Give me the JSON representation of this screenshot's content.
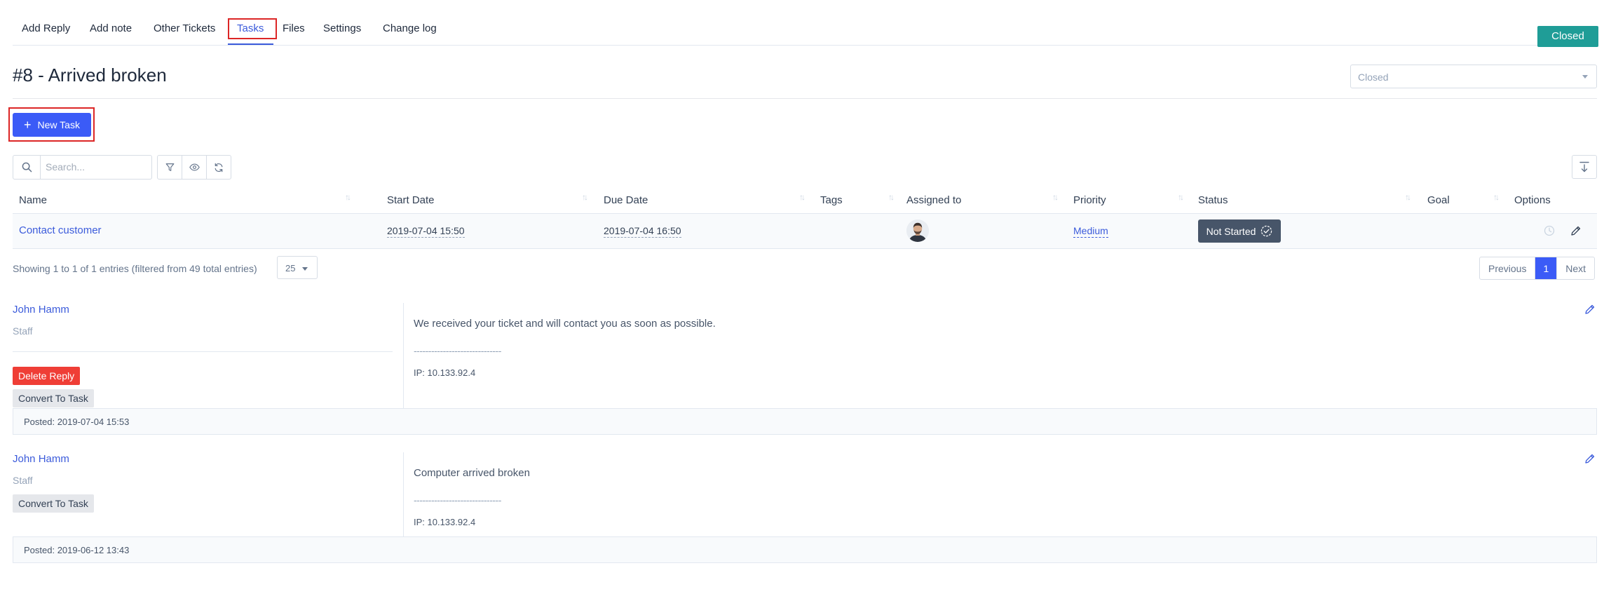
{
  "tabs": [
    {
      "label": "Add Reply"
    },
    {
      "label": "Add note"
    },
    {
      "label": "Other Tickets"
    },
    {
      "label": "Tasks"
    },
    {
      "label": "Files"
    },
    {
      "label": "Settings"
    },
    {
      "label": "Change log"
    }
  ],
  "active_tab": "Tasks",
  "status_button": "Closed",
  "ticket": {
    "title": "#8 - Arrived broken",
    "status_select": "Closed"
  },
  "new_task_label": "New Task",
  "search": {
    "placeholder": "Search..."
  },
  "table": {
    "headers": [
      "Name",
      "Start Date",
      "Due Date",
      "Tags",
      "Assigned to",
      "Priority",
      "Status",
      "Goal",
      "Options"
    ],
    "rows": [
      {
        "name": "Contact customer",
        "start_date": "2019-07-04 15:50",
        "due_date": "2019-07-04 16:50",
        "tags": "",
        "priority": "Medium",
        "status": "Not Started",
        "goal": ""
      }
    ]
  },
  "pagination": {
    "showing": "Showing 1 to 1 of 1 entries (filtered from 49 total entries)",
    "page_length": "25",
    "previous": "Previous",
    "current_page": "1",
    "next": "Next"
  },
  "replies": [
    {
      "author": "John Hamm",
      "role": "Staff",
      "delete_label": "Delete Reply",
      "convert_label": "Convert To Task",
      "message": "We received your ticket and will contact you as soon as possible.",
      "separator": "------------------------------",
      "ip": "IP: 10.133.92.4",
      "posted": "Posted: 2019-07-04 15:53"
    },
    {
      "author": "John Hamm",
      "role": "Staff",
      "convert_label": "Convert To Task",
      "message": "Computer arrived broken",
      "separator": "------------------------------",
      "ip": "IP: 10.133.92.4",
      "posted": "Posted: 2019-06-12 13:43"
    }
  ],
  "colors": {
    "accent": "#3b5bf7",
    "link": "#3b5bdb",
    "closed": "#1f9d97",
    "danger": "#ef3e36",
    "highlight_border": "#dc2626",
    "status_badge": "#475569"
  },
  "icons": {
    "search": "search-icon",
    "filter": "filter-icon",
    "visibility": "eye-icon",
    "refresh": "refresh-icon",
    "export": "export-icon",
    "timer": "clock-icon",
    "edit": "pencil-icon",
    "status": "check-circle-icon"
  }
}
